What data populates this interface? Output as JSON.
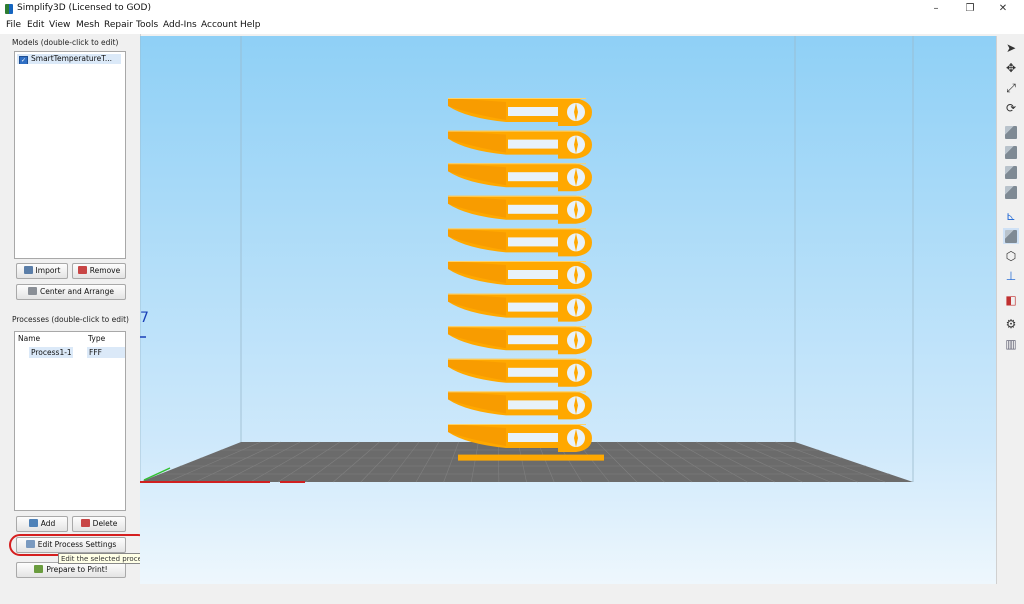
{
  "window": {
    "title": "Simplify3D (Licensed to GOD)",
    "controls": {
      "minimize": "–",
      "maximize": "❐",
      "close": "✕"
    }
  },
  "menu": [
    "File",
    "Edit",
    "View",
    "Mesh",
    "Repair",
    "Tools",
    "Add-Ins",
    "Account",
    "Help"
  ],
  "models": {
    "label": "Models (double-click to edit)",
    "items": [
      {
        "name": "SmartTemperatureT...",
        "checked": true
      }
    ],
    "import_label": "Import",
    "remove_label": "Remove",
    "center_arrange_label": "Center and Arrange"
  },
  "processes": {
    "label": "Processes (double-click to edit)",
    "col_name": "Name",
    "col_type": "Type",
    "rows": [
      {
        "name": "Process1-1",
        "type": "FFF"
      }
    ],
    "add_label": "Add",
    "delete_label": "Delete",
    "edit_settings_label": "Edit Process Settings",
    "tooltip": "Edit the selected process settings",
    "prepare_label": "Prepare to Print!"
  },
  "viewport": {
    "axis_marker": "7",
    "colors": {
      "sky_top": "#8fd0f6",
      "sky_bottom": "#eaf5fd",
      "bed": "#6b6b6b",
      "model": "#ffa800"
    },
    "tower_tiers": 11
  },
  "toolbar": {
    "icons": [
      "select-arrow-icon",
      "move-icon",
      "scale-icon",
      "rotate-icon",
      "view-front-icon",
      "view-top-icon",
      "view-left-icon",
      "view-right-icon",
      "axes-icon",
      "solid-view-icon",
      "wireframe-view-icon",
      "origin-icon",
      "cross-section-icon",
      "settings-gear-icon",
      "layers-icon"
    ]
  }
}
